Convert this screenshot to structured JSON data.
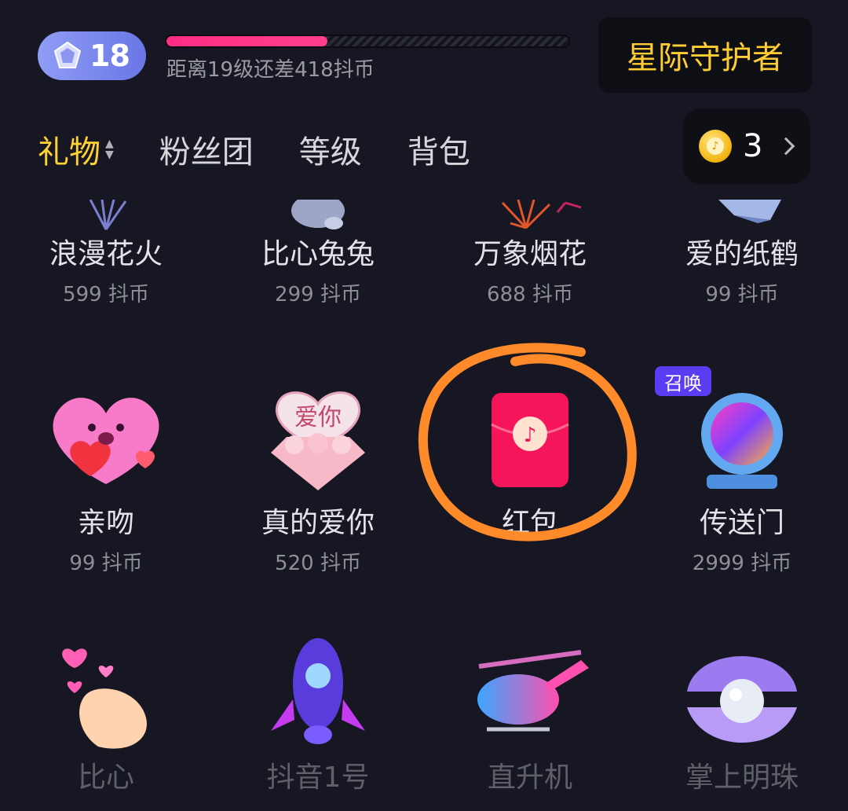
{
  "header": {
    "level": "18",
    "progress_text": "距离19级还差418抖币",
    "progress_fraction": 0.4,
    "guard_label": "星际守护者"
  },
  "tabs": [
    {
      "label": "礼物",
      "active": true
    },
    {
      "label": "粉丝团",
      "active": false
    },
    {
      "label": "等级",
      "active": false
    },
    {
      "label": "背包",
      "active": false
    }
  ],
  "coin_balance": "3",
  "gifts": [
    {
      "name": "浪漫花火",
      "price": "599 抖币",
      "icon": "firework-icon"
    },
    {
      "name": "比心兔兔",
      "price": "299 抖币",
      "icon": "rabbit-icon"
    },
    {
      "name": "万象烟花",
      "price": "688 抖币",
      "icon": "fireworks-icon"
    },
    {
      "name": "爱的纸鹤",
      "price": "99 抖币",
      "icon": "paper-crane-icon"
    },
    {
      "name": "亲吻",
      "price": "99 抖币",
      "icon": "kiss-heart-icon"
    },
    {
      "name": "真的爱你",
      "price": "520 抖币",
      "icon": "love-heart-box-icon",
      "art_text": "爱你"
    },
    {
      "name": "红包",
      "price": "",
      "icon": "red-envelope-icon"
    },
    {
      "name": "传送门",
      "price": "2999 抖币",
      "icon": "portal-icon",
      "tag": "召唤"
    },
    {
      "name": "比心",
      "price": "",
      "icon": "finger-heart-icon"
    },
    {
      "name": "抖音1号",
      "price": "",
      "icon": "rocket-icon"
    },
    {
      "name": "直升机",
      "price": "",
      "icon": "helicopter-icon"
    },
    {
      "name": "掌上明珠",
      "price": "",
      "icon": "pearl-shell-icon"
    }
  ],
  "colors": {
    "background": "#161722",
    "accent_yellow": "#ffd233",
    "progress_pink": "#ff2d84",
    "annotation_orange": "#ff8a2a",
    "tag_purple": "#5b3cf2"
  }
}
